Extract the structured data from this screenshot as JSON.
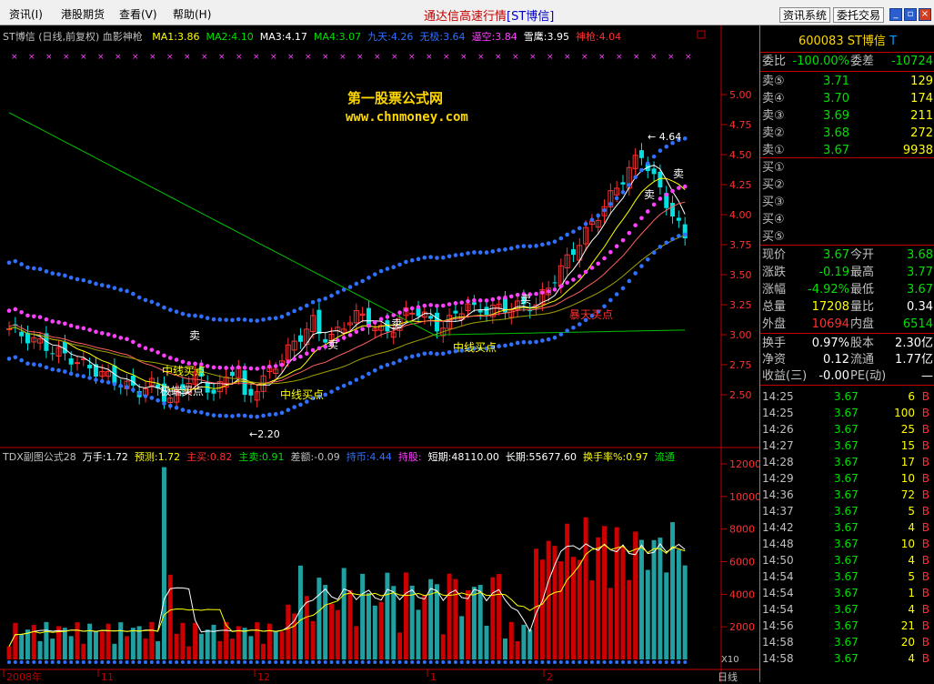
{
  "menu": {
    "items": [
      "资讯(I)",
      "港股期货",
      "查看(V)",
      "帮助(H)"
    ]
  },
  "window": {
    "title_prefix": "通达信高速行情",
    "title_symbol": "[ST博信]",
    "btn_news": "资讯系统",
    "btn_trade": "委托交易"
  },
  "main_header": {
    "name": "ST博信 (日线,前复权) 血影神枪",
    "items": [
      {
        "text": "MA1:3.86",
        "color": "#ffff00"
      },
      {
        "text": "MA2:4.10",
        "color": "#00e000"
      },
      {
        "text": "MA3:4.17",
        "color": "#ffffff"
      },
      {
        "text": "MA4:3.07",
        "color": "#00e000"
      },
      {
        "text": "九天:4.26",
        "color": "#3070ff"
      },
      {
        "text": "无极:3.64",
        "color": "#3070ff"
      },
      {
        "text": "逼空:3.84",
        "color": "#ff40ff"
      },
      {
        "text": "雪鹰:3.95",
        "color": "#ffffff"
      },
      {
        "text": "神枪:4.04",
        "color": "#ff3030"
      }
    ]
  },
  "watermark": {
    "line1": "第一股票公式网",
    "line2": "www.chnmoney.com"
  },
  "price_axis": [
    "5.00",
    "4.75",
    "4.50",
    "4.25",
    "4.00",
    "3.75",
    "3.50",
    "3.25",
    "3.00",
    "2.75",
    "2.50"
  ],
  "annotations": {
    "high": "4.64",
    "low": "2.20"
  },
  "signals": [
    "中线买点",
    "极端买点",
    "中线买点",
    "中线买点",
    "卖",
    "卖",
    "卖",
    "卖",
    "卖",
    "卖",
    "暴天买点"
  ],
  "sub_header": {
    "items": [
      {
        "text": "TDX副图公式28",
        "color": "#c0c0c0"
      },
      {
        "text": "万手:1.72",
        "color": "#ffffff"
      },
      {
        "text": "预测:1.72",
        "color": "#ffff00"
      },
      {
        "text": "主买:0.82",
        "color": "#ff3030"
      },
      {
        "text": "主卖:0.91",
        "color": "#00e000"
      },
      {
        "text": "差额:-0.09",
        "color": "#c0c0c0"
      },
      {
        "text": "持币:4.44",
        "color": "#3070ff"
      },
      {
        "text": "持股:",
        "color": "#ff40ff"
      },
      {
        "text": "短期:48110.00",
        "color": "#ffffff"
      },
      {
        "text": "长期:55677.60",
        "color": "#ffffff"
      },
      {
        "text": "换手率%:0.97",
        "color": "#ffff00"
      },
      {
        "text": "流通",
        "color": "#00e000"
      }
    ]
  },
  "vol_axis": [
    "12000",
    "10000",
    "8000",
    "6000",
    "4000",
    "2000"
  ],
  "vol_unit": "X10",
  "date_axis": [
    "2008年",
    "11",
    "12",
    "1",
    "2"
  ],
  "period_label": "日线",
  "quote": {
    "title": "600083 ST博信",
    "weibi_label": "委比",
    "weibi": "-100.00%",
    "weicha_label": "委差",
    "weicha": "-10724",
    "asks": [
      {
        "label": "卖⑤",
        "price": "3.71",
        "vol": "129"
      },
      {
        "label": "卖④",
        "price": "3.70",
        "vol": "174"
      },
      {
        "label": "卖③",
        "price": "3.69",
        "vol": "211"
      },
      {
        "label": "卖②",
        "price": "3.68",
        "vol": "272"
      },
      {
        "label": "卖①",
        "price": "3.67",
        "vol": "9938"
      }
    ],
    "bids": [
      {
        "label": "买①"
      },
      {
        "label": "买②"
      },
      {
        "label": "买③"
      },
      {
        "label": "买④"
      },
      {
        "label": "买⑤"
      }
    ],
    "stats": [
      {
        "l1": "现价",
        "v1": "3.67",
        "c1": "grn",
        "l2": "今开",
        "v2": "3.68",
        "c2": "grn"
      },
      {
        "l1": "涨跌",
        "v1": "-0.19",
        "c1": "grn",
        "l2": "最高",
        "v2": "3.77",
        "c2": "grn"
      },
      {
        "l1": "涨幅",
        "v1": "-4.92%",
        "c1": "grn",
        "l2": "最低",
        "v2": "3.67",
        "c2": "grn"
      },
      {
        "l1": "总量",
        "v1": "17208",
        "c1": "yel",
        "l2": "量比",
        "v2": "0.34",
        "c2": "wht"
      },
      {
        "l1": "外盘",
        "v1": "10694",
        "c1": "red",
        "l2": "内盘",
        "v2": "6514",
        "c2": "grn"
      }
    ],
    "stats2": [
      {
        "l1": "换手",
        "v1": "0.97%",
        "l2": "股本",
        "v2": "2.30亿"
      },
      {
        "l1": "净资",
        "v1": "0.12",
        "l2": "流通",
        "v2": "1.77亿"
      },
      {
        "l1": "收益(三)",
        "v1": "-0.00",
        "l2": "PE(动)",
        "v2": "—"
      }
    ],
    "ticks": [
      {
        "t": "14:25",
        "p": "3.67",
        "q": "6",
        "s": "B"
      },
      {
        "t": "14:25",
        "p": "3.67",
        "q": "100",
        "s": "B"
      },
      {
        "t": "14:26",
        "p": "3.67",
        "q": "25",
        "s": "B"
      },
      {
        "t": "14:27",
        "p": "3.67",
        "q": "15",
        "s": "B"
      },
      {
        "t": "14:28",
        "p": "3.67",
        "q": "17",
        "s": "B"
      },
      {
        "t": "14:29",
        "p": "3.67",
        "q": "10",
        "s": "B"
      },
      {
        "t": "14:36",
        "p": "3.67",
        "q": "72",
        "s": "B"
      },
      {
        "t": "14:37",
        "p": "3.67",
        "q": "5",
        "s": "B"
      },
      {
        "t": "14:42",
        "p": "3.67",
        "q": "4",
        "s": "B"
      },
      {
        "t": "14:48",
        "p": "3.67",
        "q": "10",
        "s": "B"
      },
      {
        "t": "14:50",
        "p": "3.67",
        "q": "4",
        "s": "B"
      },
      {
        "t": "14:54",
        "p": "3.67",
        "q": "5",
        "s": "B"
      },
      {
        "t": "14:54",
        "p": "3.67",
        "q": "1",
        "s": "B"
      },
      {
        "t": "14:54",
        "p": "3.67",
        "q": "4",
        "s": "B"
      },
      {
        "t": "14:56",
        "p": "3.67",
        "q": "21",
        "s": "B"
      },
      {
        "t": "14:58",
        "p": "3.67",
        "q": "20",
        "s": "B"
      },
      {
        "t": "14:58",
        "p": "3.67",
        "q": "4",
        "s": "B"
      }
    ]
  },
  "colors": {
    "up": "#ff3030",
    "down": "#00e0e0",
    "vol_up": "#cc0000",
    "vol_down": "#20a0a0",
    "line1": "#ffffff",
    "line2": "#ffff00",
    "ma_green": "#00c000",
    "dots_blue": "#3070ff",
    "dots_pink": "#ff40ff"
  }
}
